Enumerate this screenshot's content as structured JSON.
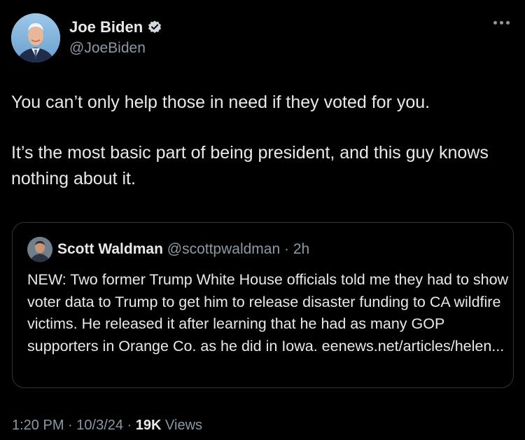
{
  "author": {
    "name": "Joe Biden",
    "handle": "@JoeBiden",
    "verified": true
  },
  "icons": {
    "verified": "verified-badge-icon",
    "more": "more-options-icon"
  },
  "colors": {
    "background": "#000000",
    "text": "#e7e9ea",
    "muted": "#8b98a5",
    "border": "#2f3336"
  },
  "tweet": {
    "paragraphs": [
      "You can’t only help those in need if they voted for you.",
      "It’s the most basic part of being president, and this guy knows nothing about it."
    ]
  },
  "quote": {
    "name": "Scott Waldman",
    "handle": "@scottpwaldman",
    "separator": " · ",
    "time": "2h",
    "text": "NEW: Two former Trump White House officials told me they had to show voter data to Trump to get him to release disaster funding to CA wildfire victims. He released it after learning that he had as many GOP supporters in Orange Co. as he did in Iowa. eenews.net/articles/helen..."
  },
  "footer": {
    "time": "1:20 PM",
    "sep1": " · ",
    "date": "10/3/24",
    "sep2": " · ",
    "views_count": "19K",
    "views_label": " Views"
  }
}
